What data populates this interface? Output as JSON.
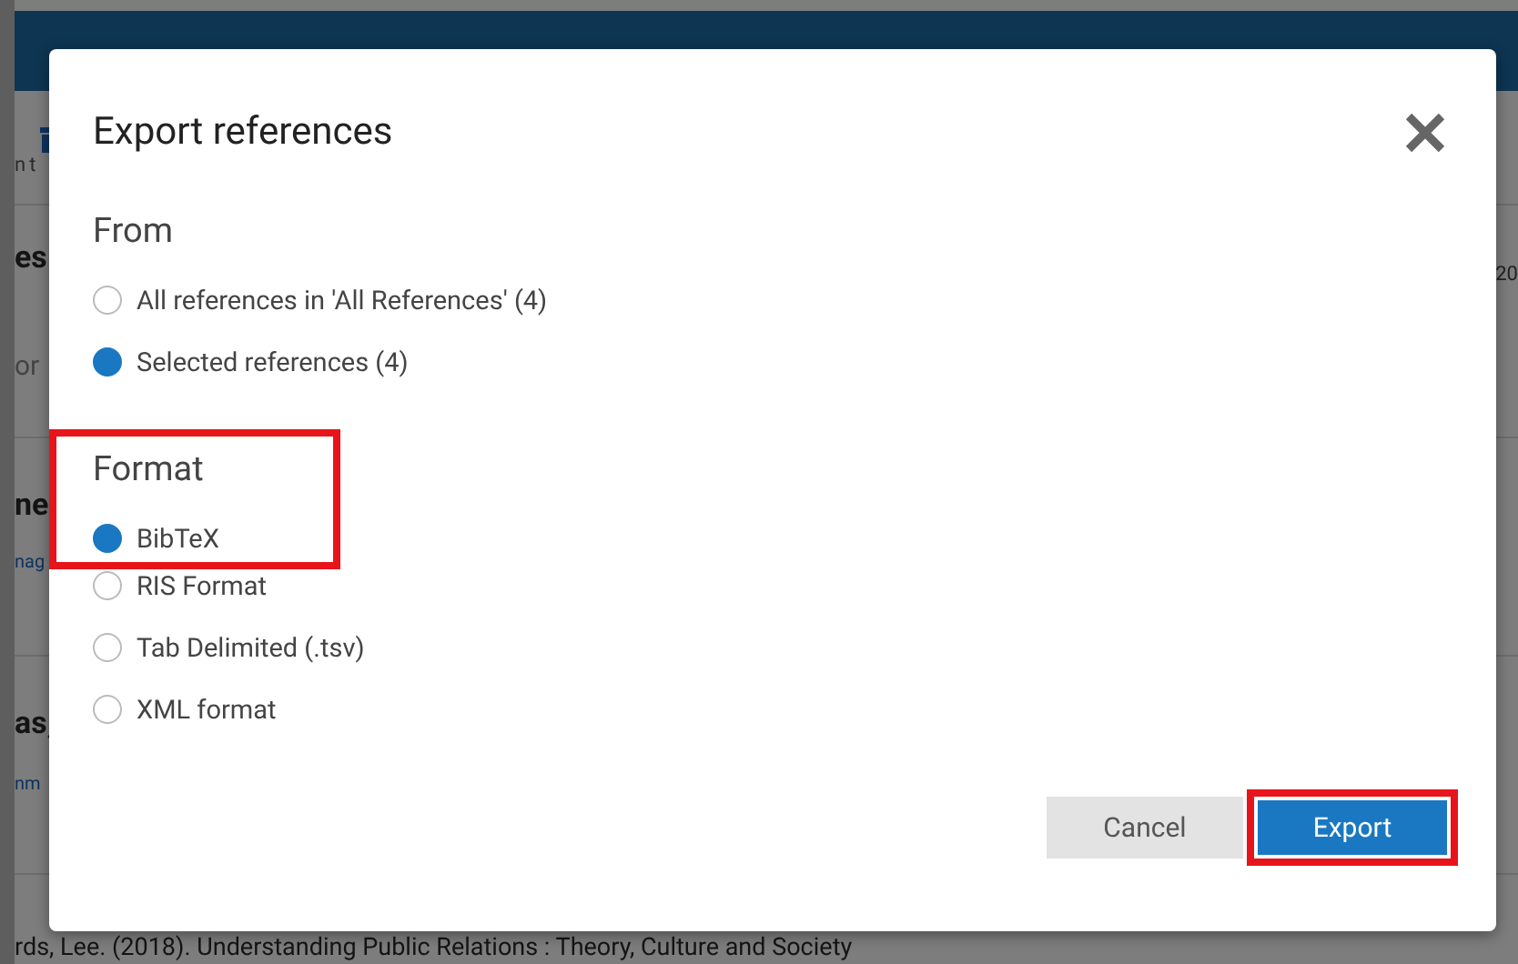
{
  "background": {
    "left_fragments": [
      {
        "text": "nt",
        "kind": "small"
      },
      {
        "text": "es",
        "kind": "bold"
      },
      {
        "text": "or",
        "kind": "muted"
      },
      {
        "text": "ne",
        "kind": "bold"
      },
      {
        "text": "nag",
        "kind": "link"
      },
      {
        "text": "as,",
        "kind": "bold"
      },
      {
        "text": "nm",
        "kind": "link"
      }
    ],
    "right_fragment": "20",
    "bottom_text": "rds, Lee. (2018). Understanding Public Relations : Theory, Culture and Society"
  },
  "dialog": {
    "title": "Export references",
    "sections": [
      {
        "heading": "From",
        "highlighted": false,
        "options": [
          {
            "label": "All references in 'All References' (4)",
            "selected": false
          },
          {
            "label": "Selected references (4)",
            "selected": true
          }
        ]
      },
      {
        "heading": "Format",
        "highlighted": true,
        "options": [
          {
            "label": "BibTeX",
            "selected": true
          },
          {
            "label": "RIS Format",
            "selected": false
          },
          {
            "label": "Tab Delimited (.tsv)",
            "selected": false
          },
          {
            "label": "XML format",
            "selected": false
          }
        ]
      }
    ],
    "buttons": [
      {
        "label": "Cancel",
        "kind": "secondary",
        "highlighted": false
      },
      {
        "label": "Export",
        "kind": "primary",
        "highlighted": true
      }
    ]
  }
}
